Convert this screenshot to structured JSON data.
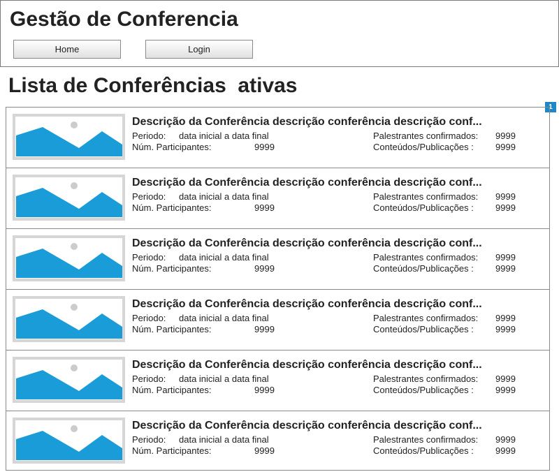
{
  "header": {
    "app_title": "Gestão de Conferencia",
    "nav": [
      {
        "label": "Home"
      },
      {
        "label": "Login"
      }
    ]
  },
  "page": {
    "title": "Lista de Conferências  ativas",
    "marker": "1"
  },
  "icons": {
    "thumbnail": "image-placeholder-icon"
  },
  "colors": {
    "accent": "#1e88c7",
    "thumbnail_bg": "#d6d6d6",
    "mountain": "#199cd8"
  },
  "conferences": [
    {
      "description": "Descrição da Conferência descrição conferência descrição conf...",
      "periodo_label": "Periodo:",
      "periodo_value": "data inicial a data final",
      "participantes_label": "Núm. Participantes:",
      "participantes_value": "9999",
      "palestrantes_label": "Palestrantes confirmados:",
      "palestrantes_value": "9999",
      "conteudos_label": "Conteúdos/Publicações :",
      "conteudos_value": "9999"
    },
    {
      "description": "Descrição da Conferência descrição conferência descrição conf...",
      "periodo_label": "Periodo:",
      "periodo_value": "data inicial a data final",
      "participantes_label": "Núm. Participantes:",
      "participantes_value": "9999",
      "palestrantes_label": "Palestrantes confirmados:",
      "palestrantes_value": "9999",
      "conteudos_label": "Conteúdos/Publicações :",
      "conteudos_value": "9999"
    },
    {
      "description": "Descrição da Conferência descrição conferência descrição conf...",
      "periodo_label": "Periodo:",
      "periodo_value": "data inicial a data final",
      "participantes_label": "Núm. Participantes:",
      "participantes_value": "9999",
      "palestrantes_label": "Palestrantes confirmados:",
      "palestrantes_value": "9999",
      "conteudos_label": "Conteúdos/Publicações :",
      "conteudos_value": "9999"
    },
    {
      "description": "Descrição da Conferência descrição conferência descrição conf...",
      "periodo_label": "Periodo:",
      "periodo_value": "data inicial a data final",
      "participantes_label": "Núm. Participantes:",
      "participantes_value": "9999",
      "palestrantes_label": "Palestrantes confirmados:",
      "palestrantes_value": "9999",
      "conteudos_label": "Conteúdos/Publicações :",
      "conteudos_value": "9999"
    },
    {
      "description": "Descrição da Conferência descrição conferência descrição conf...",
      "periodo_label": "Periodo:",
      "periodo_value": "data inicial a data final",
      "participantes_label": "Núm. Participantes:",
      "participantes_value": "9999",
      "palestrantes_label": "Palestrantes confirmados:",
      "palestrantes_value": "9999",
      "conteudos_label": "Conteúdos/Publicações :",
      "conteudos_value": "9999"
    },
    {
      "description": "Descrição da Conferência descrição conferência descrição conf...",
      "periodo_label": "Periodo:",
      "periodo_value": "data inicial a data final",
      "participantes_label": "Núm. Participantes:",
      "participantes_value": "9999",
      "palestrantes_label": "Palestrantes confirmados:",
      "palestrantes_value": "9999",
      "conteudos_label": "Conteúdos/Publicações :",
      "conteudos_value": "9999"
    }
  ]
}
